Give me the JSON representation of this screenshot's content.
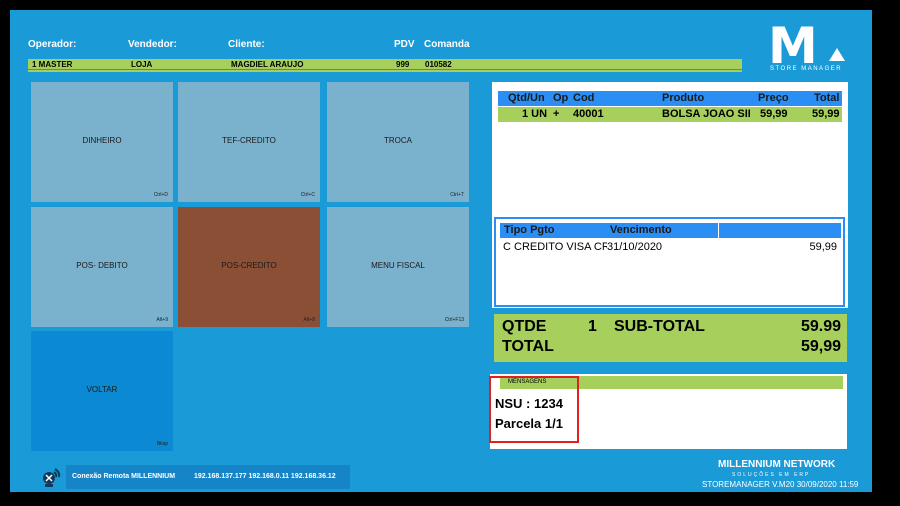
{
  "header": {
    "operador_label": "Operador:",
    "vendedor_label": "Vendedor:",
    "cliente_label": "Cliente:",
    "pdv_label": "PDV",
    "comanda_label": "Comanda",
    "operador_value": "1 MASTER",
    "vendedor_value": "LOJA",
    "cliente_value": "MAGDIEL ARAUJO",
    "pdv_value": "999",
    "comanda_value": "010582"
  },
  "logo": {
    "letter": "M",
    "subtitle": "STORE MANAGER"
  },
  "tiles": [
    {
      "label": "DINHEIRO",
      "shortcut": "Ctrl+D"
    },
    {
      "label": "TEF-CREDITO",
      "shortcut": "Ctrl+C"
    },
    {
      "label": "TROCA",
      "shortcut": "Ctrl+T"
    },
    {
      "label": "POS- DEBITO",
      "shortcut": "Alt+9"
    },
    {
      "label": "POS-CREDITO",
      "shortcut": "Alt+8"
    },
    {
      "label": "MENU FISCAL",
      "shortcut": "Ctrl+F13"
    },
    {
      "label": "VOLTAR",
      "shortcut": "Bksp"
    }
  ],
  "items_table": {
    "headers": [
      "Qtd/Un",
      "Op",
      "Cod",
      "Produto",
      "Preço",
      "Total"
    ],
    "rows": [
      [
        "1 UN",
        "+",
        "40001",
        "BOLSA JOAO SILV",
        "59,99",
        "59,99"
      ]
    ]
  },
  "payment_table": {
    "headers": [
      "Tipo Pgto",
      "Vencimento",
      ""
    ],
    "rows": [
      [
        "C CREDITO VISA CRE",
        "31/10/2020",
        "59,99"
      ]
    ]
  },
  "totals": {
    "qtde_label": "QTDE",
    "qtde_value": "1",
    "subtotal_label": "SUB-TOTAL",
    "subtotal_value": "59.99",
    "total_label": "TOTAL",
    "total_value": "59,99"
  },
  "messages": {
    "title": "MENSAGENS",
    "line1": "NSU : 1234",
    "line2": "Parcela 1/1"
  },
  "footer": {
    "connection_label": "Conexão Remota MILLENNIUM",
    "ips": "192.168.137.177 192.168.0.11 192.168.36.12",
    "brand": "MILLENNIUM NETWORK",
    "brand_sub": "SOLUÇÕES EM ERP",
    "version_line": "STOREMANAGER V.M20   30/09/2020 11:59"
  },
  "colors": {
    "background": "#1b9ad8",
    "accent_green": "#a6cf5c",
    "header_blue": "#2a8ef5",
    "tile": "#7ab1cc",
    "tile_selected": "#8b4f35",
    "tile_back": "#0b8ad3",
    "highlight": "#e12020"
  }
}
